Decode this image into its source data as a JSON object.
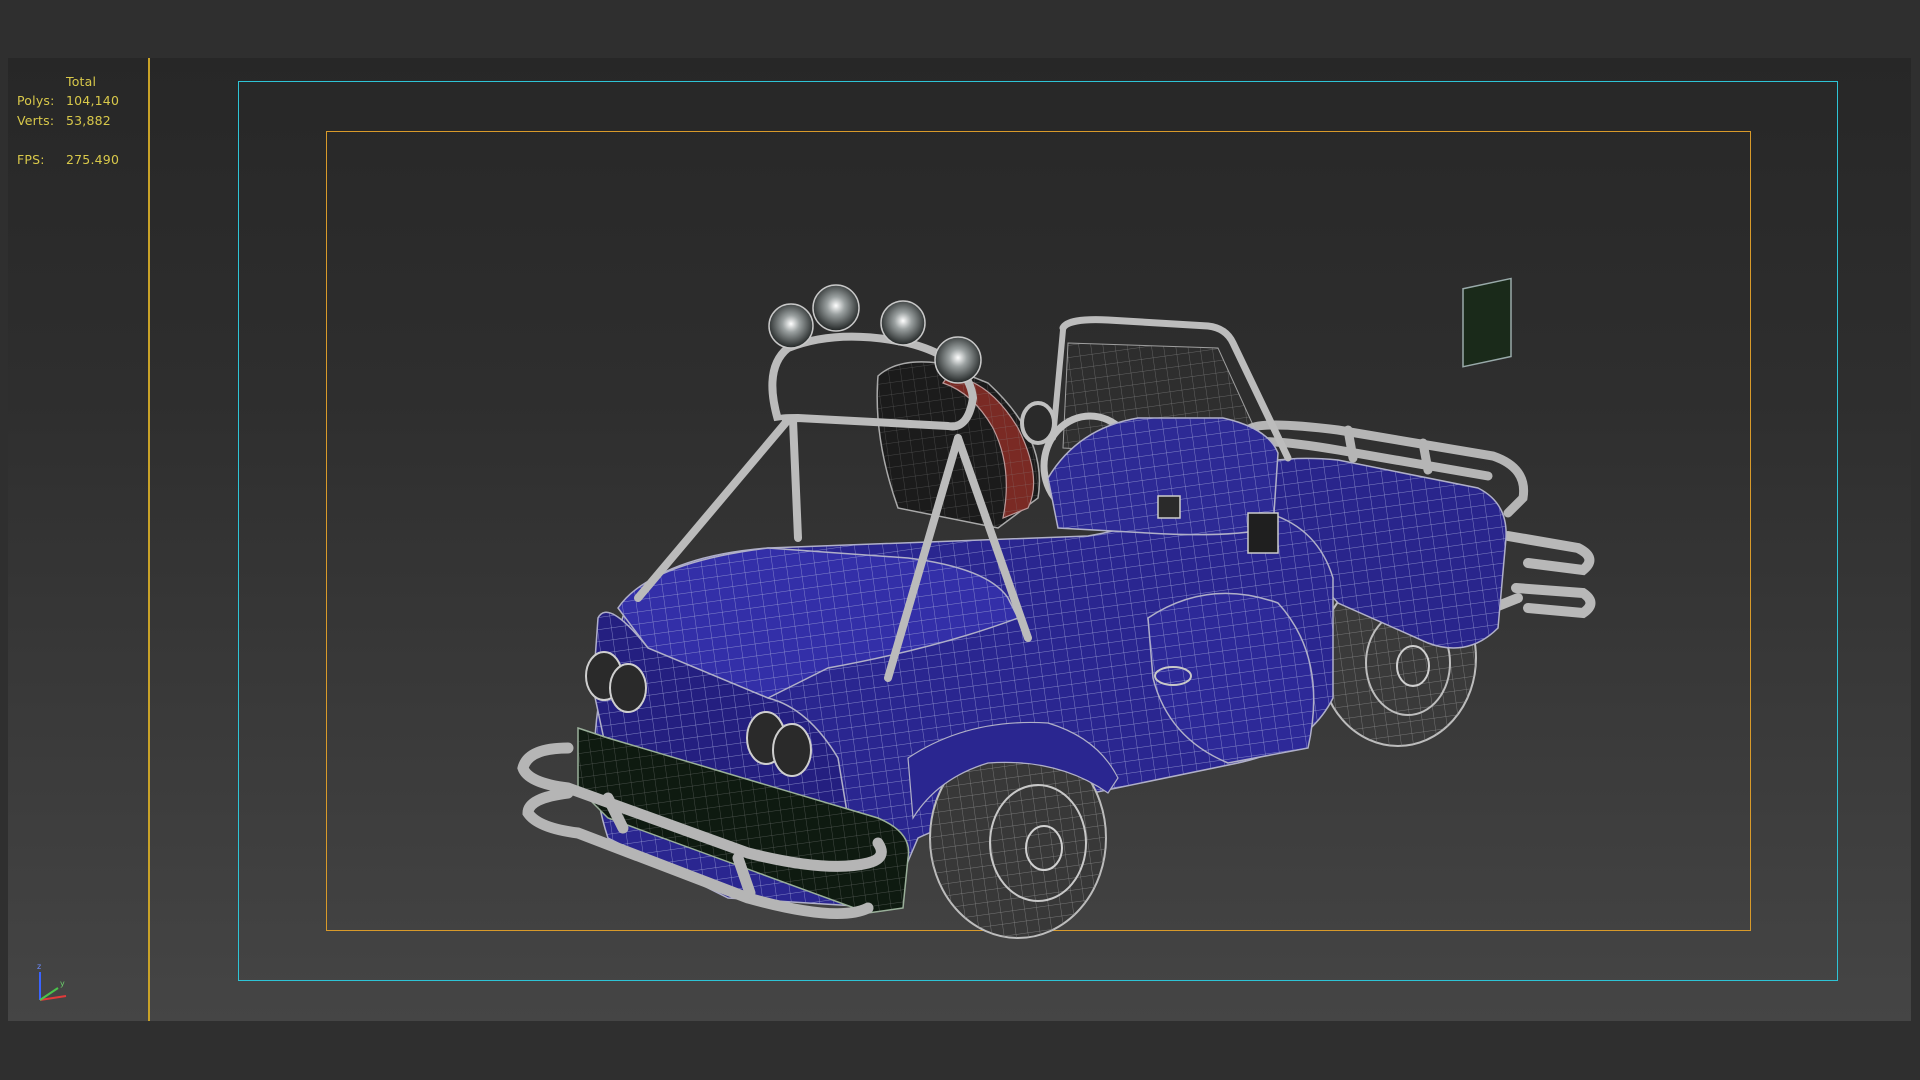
{
  "stats": {
    "header": "Total",
    "polys_label": "Polys:",
    "polys_value": "104,140",
    "verts_label": "Verts:",
    "verts_value": "53,882",
    "fps_label": "FPS:",
    "fps_value": "275.490"
  },
  "gizmo": {
    "z_label": "z",
    "y_label": "y"
  },
  "colors": {
    "stat_text": "#d8c84a",
    "safe_frame_outer": "#2ec4d6",
    "safe_frame_inner": "#d89a2a",
    "divider": "#c9a227",
    "car_body": "#2a2590",
    "wire": "#c8c8c8"
  }
}
